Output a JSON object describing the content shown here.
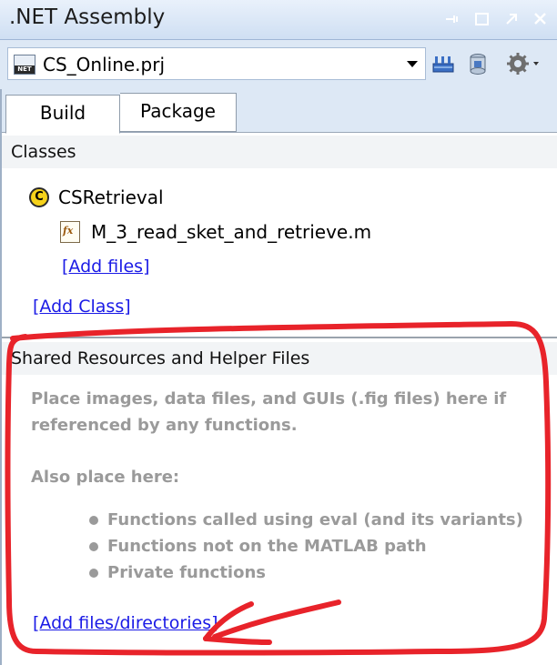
{
  "titlebar": {
    "title": ".NET Assembly",
    "icons": [
      "pin-icon",
      "maximize-icon",
      "undock-icon",
      "close-icon"
    ]
  },
  "project": {
    "name": "CS_Online.prj",
    "project_icon": "net-project-icon",
    "tools": [
      "build-icon",
      "package-icon",
      "settings-gear-icon"
    ]
  },
  "tabs": [
    {
      "label": "Build",
      "selected": true
    },
    {
      "label": "Package",
      "selected": false
    }
  ],
  "classes": {
    "header": "Classes",
    "class_icon_letter": "C",
    "items": [
      {
        "name": "CSRetrieval",
        "files": [
          "M_3_read_sket_and_retrieve.m"
        ],
        "fx_label": "fx",
        "add_files": "[Add files]"
      }
    ],
    "add_class": "[Add Class]"
  },
  "shared": {
    "header": "Shared Resources and Helper Files",
    "hint_line1": "Place images, data files, and GUIs (.fig files) here if referenced by any functions.",
    "also_place": "Also place here:",
    "bullets": [
      "Functions called using eval (and its variants)",
      "Functions not on the MATLAB path",
      "Private functions"
    ],
    "add_dirs": "[Add files/directories]"
  },
  "annotation_color": "#e8232a",
  "net_badge": "NET"
}
